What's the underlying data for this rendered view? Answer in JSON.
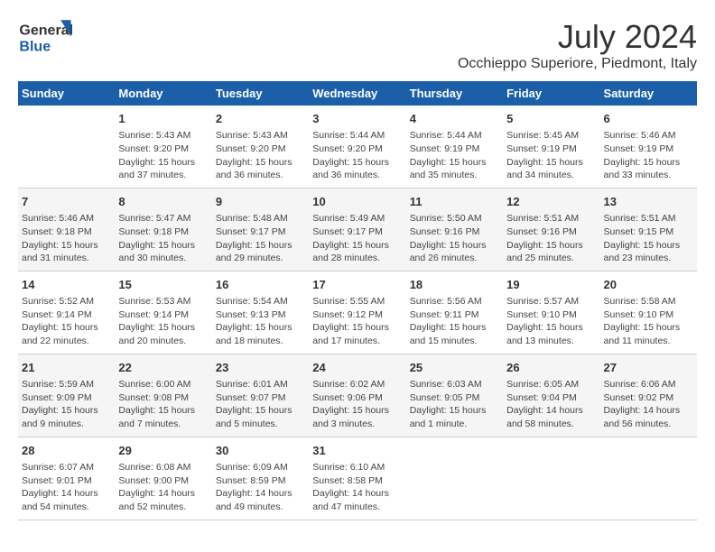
{
  "logo": {
    "line1": "General",
    "line2": "Blue"
  },
  "title": "July 2024",
  "subtitle": "Occhieppo Superiore, Piedmont, Italy",
  "headers": [
    "Sunday",
    "Monday",
    "Tuesday",
    "Wednesday",
    "Thursday",
    "Friday",
    "Saturday"
  ],
  "weeks": [
    [
      {
        "day": "",
        "info": ""
      },
      {
        "day": "1",
        "info": "Sunrise: 5:43 AM\nSunset: 9:20 PM\nDaylight: 15 hours\nand 37 minutes."
      },
      {
        "day": "2",
        "info": "Sunrise: 5:43 AM\nSunset: 9:20 PM\nDaylight: 15 hours\nand 36 minutes."
      },
      {
        "day": "3",
        "info": "Sunrise: 5:44 AM\nSunset: 9:20 PM\nDaylight: 15 hours\nand 36 minutes."
      },
      {
        "day": "4",
        "info": "Sunrise: 5:44 AM\nSunset: 9:19 PM\nDaylight: 15 hours\nand 35 minutes."
      },
      {
        "day": "5",
        "info": "Sunrise: 5:45 AM\nSunset: 9:19 PM\nDaylight: 15 hours\nand 34 minutes."
      },
      {
        "day": "6",
        "info": "Sunrise: 5:46 AM\nSunset: 9:19 PM\nDaylight: 15 hours\nand 33 minutes."
      }
    ],
    [
      {
        "day": "7",
        "info": "Sunrise: 5:46 AM\nSunset: 9:18 PM\nDaylight: 15 hours\nand 31 minutes."
      },
      {
        "day": "8",
        "info": "Sunrise: 5:47 AM\nSunset: 9:18 PM\nDaylight: 15 hours\nand 30 minutes."
      },
      {
        "day": "9",
        "info": "Sunrise: 5:48 AM\nSunset: 9:17 PM\nDaylight: 15 hours\nand 29 minutes."
      },
      {
        "day": "10",
        "info": "Sunrise: 5:49 AM\nSunset: 9:17 PM\nDaylight: 15 hours\nand 28 minutes."
      },
      {
        "day": "11",
        "info": "Sunrise: 5:50 AM\nSunset: 9:16 PM\nDaylight: 15 hours\nand 26 minutes."
      },
      {
        "day": "12",
        "info": "Sunrise: 5:51 AM\nSunset: 9:16 PM\nDaylight: 15 hours\nand 25 minutes."
      },
      {
        "day": "13",
        "info": "Sunrise: 5:51 AM\nSunset: 9:15 PM\nDaylight: 15 hours\nand 23 minutes."
      }
    ],
    [
      {
        "day": "14",
        "info": "Sunrise: 5:52 AM\nSunset: 9:14 PM\nDaylight: 15 hours\nand 22 minutes."
      },
      {
        "day": "15",
        "info": "Sunrise: 5:53 AM\nSunset: 9:14 PM\nDaylight: 15 hours\nand 20 minutes."
      },
      {
        "day": "16",
        "info": "Sunrise: 5:54 AM\nSunset: 9:13 PM\nDaylight: 15 hours\nand 18 minutes."
      },
      {
        "day": "17",
        "info": "Sunrise: 5:55 AM\nSunset: 9:12 PM\nDaylight: 15 hours\nand 17 minutes."
      },
      {
        "day": "18",
        "info": "Sunrise: 5:56 AM\nSunset: 9:11 PM\nDaylight: 15 hours\nand 15 minutes."
      },
      {
        "day": "19",
        "info": "Sunrise: 5:57 AM\nSunset: 9:10 PM\nDaylight: 15 hours\nand 13 minutes."
      },
      {
        "day": "20",
        "info": "Sunrise: 5:58 AM\nSunset: 9:10 PM\nDaylight: 15 hours\nand 11 minutes."
      }
    ],
    [
      {
        "day": "21",
        "info": "Sunrise: 5:59 AM\nSunset: 9:09 PM\nDaylight: 15 hours\nand 9 minutes."
      },
      {
        "day": "22",
        "info": "Sunrise: 6:00 AM\nSunset: 9:08 PM\nDaylight: 15 hours\nand 7 minutes."
      },
      {
        "day": "23",
        "info": "Sunrise: 6:01 AM\nSunset: 9:07 PM\nDaylight: 15 hours\nand 5 minutes."
      },
      {
        "day": "24",
        "info": "Sunrise: 6:02 AM\nSunset: 9:06 PM\nDaylight: 15 hours\nand 3 minutes."
      },
      {
        "day": "25",
        "info": "Sunrise: 6:03 AM\nSunset: 9:05 PM\nDaylight: 15 hours\nand 1 minute."
      },
      {
        "day": "26",
        "info": "Sunrise: 6:05 AM\nSunset: 9:04 PM\nDaylight: 14 hours\nand 58 minutes."
      },
      {
        "day": "27",
        "info": "Sunrise: 6:06 AM\nSunset: 9:02 PM\nDaylight: 14 hours\nand 56 minutes."
      }
    ],
    [
      {
        "day": "28",
        "info": "Sunrise: 6:07 AM\nSunset: 9:01 PM\nDaylight: 14 hours\nand 54 minutes."
      },
      {
        "day": "29",
        "info": "Sunrise: 6:08 AM\nSunset: 9:00 PM\nDaylight: 14 hours\nand 52 minutes."
      },
      {
        "day": "30",
        "info": "Sunrise: 6:09 AM\nSunset: 8:59 PM\nDaylight: 14 hours\nand 49 minutes."
      },
      {
        "day": "31",
        "info": "Sunrise: 6:10 AM\nSunset: 8:58 PM\nDaylight: 14 hours\nand 47 minutes."
      },
      {
        "day": "",
        "info": ""
      },
      {
        "day": "",
        "info": ""
      },
      {
        "day": "",
        "info": ""
      }
    ]
  ]
}
